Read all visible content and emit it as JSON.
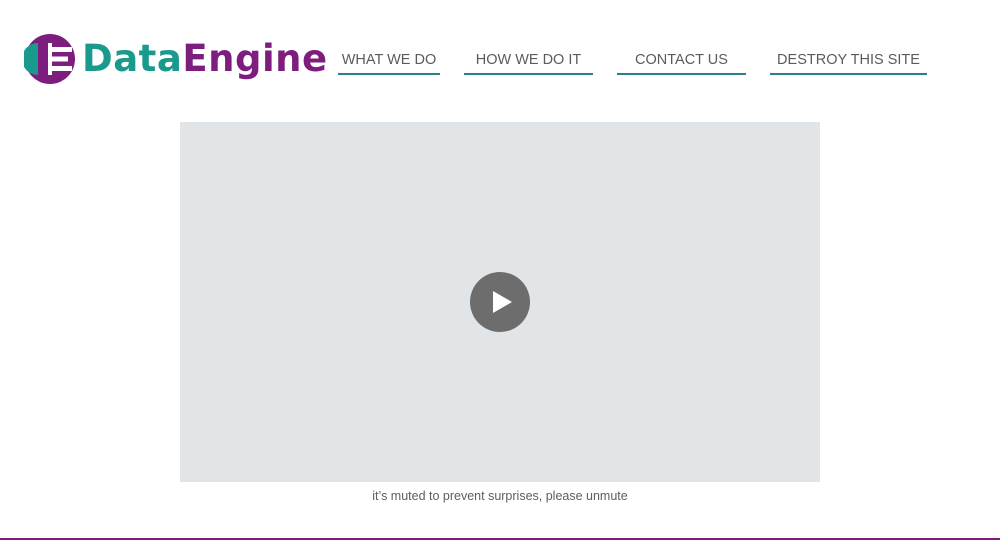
{
  "brand": {
    "name_part1": "Data",
    "name_part2": "Engine",
    "logo_icon": "dataengine-logo-icon",
    "colors": {
      "teal": "#1a9a8c",
      "purple": "#7d1d7e"
    }
  },
  "nav": {
    "items": [
      {
        "label": "WHAT WE DO"
      },
      {
        "label": "HOW WE DO IT"
      },
      {
        "label": "CONTACT US"
      },
      {
        "label": "DESTROY THIS SITE"
      }
    ],
    "underline_color": "#2f7d86"
  },
  "video": {
    "play_icon": "play-icon",
    "caption": "it’s muted to prevent surprises, please unmute",
    "placeholder_color": "#e1e5e8"
  }
}
